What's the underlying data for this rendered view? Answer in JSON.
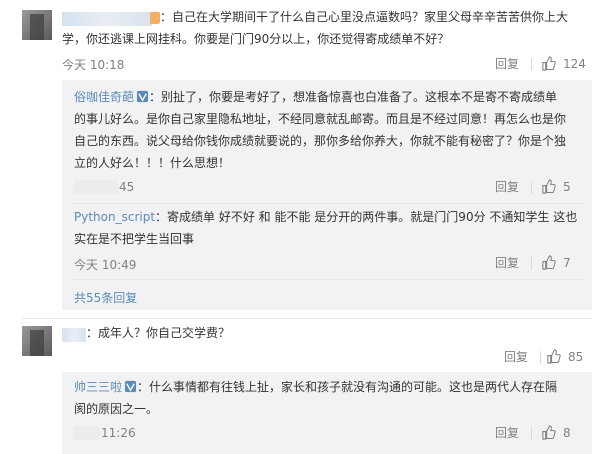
{
  "comments": [
    {
      "text_line1": "：自己在大学期间干了什么自己心里没点逼数吗？家里父母辛辛苦苦供你上大",
      "text_line2": "学，你还逃课上网挂科。你要是门门90分以上，你还觉得寄成绩单不好？",
      "time": "今天 10:18",
      "reply_label": "回复",
      "like_count": "124",
      "replies": [
        {
          "user": "俗咖佳奇葩",
          "lines": [
            "：别扯了，你要是考好了，想准备惊喜也白准备了。这根本不是寄不寄成绩单",
            "的事儿好么。是你自己家里隐私地址，不经同意就乱邮寄。而且是不经过同意！再怎么也是你",
            "自己的东西。说父母给你钱你成绩就要说的，那你多给你养大，你就不能有秘密了？你是个独",
            "立的人好么！！！什么思想！"
          ],
          "time": "45",
          "reply_label": "回复",
          "like_count": "5"
        },
        {
          "user": "Python_script",
          "lines": [
            "：寄成绩单 好不好 和 能不能 是分开的两件事。就是门门90分 不通知学生 这也",
            "实在是不把学生当回事"
          ],
          "time": "今天 10:49",
          "reply_label": "回复",
          "like_count": "7"
        }
      ],
      "more_replies": "共55条回复"
    },
    {
      "text_line1": "：成年人？你自己交学费？",
      "time": "",
      "reply_label": "回复",
      "like_count": "85",
      "replies": [
        {
          "user": "帅三三啦",
          "lines": [
            "：什么事情都有往钱上扯，家长和孩子就没有沟通的可能。这也是两代人存在隔",
            "阂的原因之一。"
          ],
          "time": "11:26",
          "reply_label": "回复",
          "like_count": "8"
        }
      ]
    }
  ],
  "icons": {
    "like": "thumbs-up-icon",
    "vip": "vip-badge-icon"
  },
  "colors": {
    "link_blue": "#5a8ab8",
    "reply_bg": "#f2f2f5",
    "meta_gray": "#808080"
  }
}
